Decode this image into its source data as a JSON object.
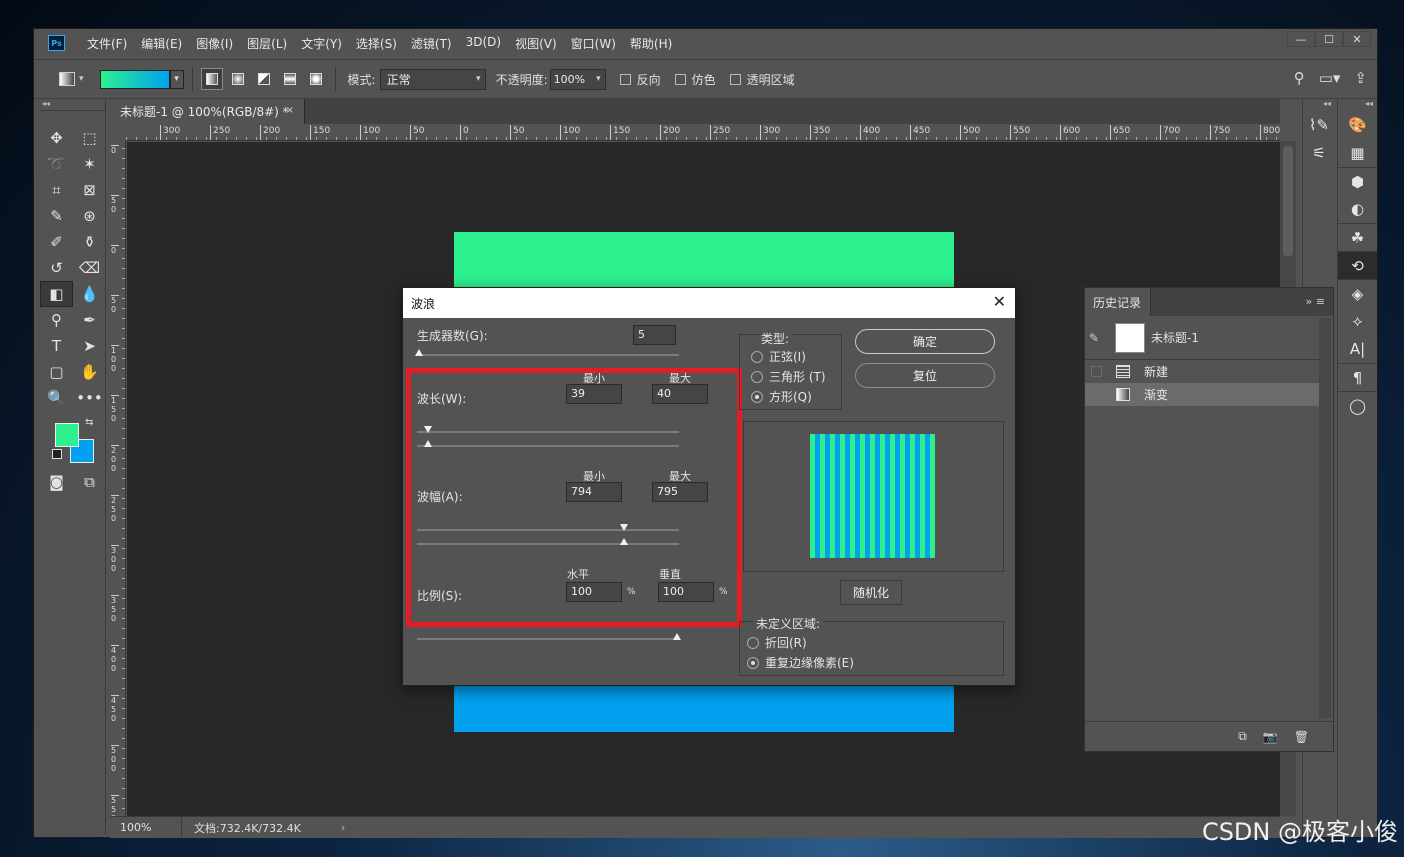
{
  "app": {
    "logo": "Ps",
    "menu": [
      "文件(F)",
      "编辑(E)",
      "图像(I)",
      "图层(L)",
      "文字(Y)",
      "选择(S)",
      "滤镜(T)",
      "3D(D)",
      "视图(V)",
      "窗口(W)",
      "帮助(H)"
    ],
    "window_controls": {
      "minimize": "—",
      "maximize": "☐",
      "close": "✕"
    }
  },
  "options_bar": {
    "mode_label": "模式:",
    "mode_value": "正常",
    "opacity_label": "不透明度:",
    "opacity_value": "100%",
    "reverse_label": "反向",
    "dither_label": "仿色",
    "transparency_label": "透明区域",
    "gradient_colors": [
      "#2cf08e",
      "#01a1f0"
    ]
  },
  "document": {
    "tab_title": "未标题-1 @ 100%(RGB/8#) *",
    "tab_close": "×",
    "ruler_h": [
      "300",
      "250",
      "200",
      "150",
      "100",
      "50",
      "0",
      "50",
      "100",
      "150",
      "200",
      "250",
      "300",
      "350",
      "400",
      "450",
      "500",
      "550",
      "600",
      "650",
      "700",
      "750",
      "800"
    ],
    "ruler_v": [
      "0",
      "50",
      "0",
      "50",
      "100",
      "150",
      "200",
      "250",
      "300",
      "350",
      "400",
      "450",
      "500",
      "550"
    ],
    "top_color": "#2cf08e",
    "bottom_color": "#01a1f0"
  },
  "status": {
    "zoom": "100%",
    "doc_info": "文档:732.4K/732.4K",
    "arrow": "›"
  },
  "tools": {
    "foreground": "#2cf08e",
    "background": "#01a1f0"
  },
  "history_panel": {
    "tab": "历史记录",
    "menu": "»  ≡",
    "snapshot": "未标题-1",
    "items": [
      "新建",
      "渐变"
    ],
    "selected_index": 1
  },
  "dialog": {
    "title": "波浪",
    "close": "✕",
    "generators_label": "生成器数(G):",
    "generators_value": "5",
    "min_label": "最小",
    "max_label": "最大",
    "wavelength_label": "波长(W):",
    "wavelength_min": "39",
    "wavelength_max": "40",
    "amplitude_label": "波幅(A):",
    "amplitude_min": "794",
    "amplitude_max": "795",
    "scale_label": "比例(S):",
    "horizontal_label": "水平",
    "vertical_label": "垂直",
    "scale_h": "100",
    "scale_v": "100",
    "percent": "%",
    "type_label": "类型:",
    "types": [
      "正弦(I)",
      "三角形 (T)",
      "方形(Q)"
    ],
    "type_selected": 2,
    "ok_button": "确定",
    "reset_button": "复位",
    "randomize_button": "随机化",
    "undefined_label": "未定义区域:",
    "undefined_options": [
      "折回(R)",
      "重复边缘像素(E)"
    ],
    "undefined_selected": 1,
    "preview_colors": [
      "#2cf08e",
      "#01a1f0"
    ]
  },
  "watermark": "CSDN @极客小俊"
}
